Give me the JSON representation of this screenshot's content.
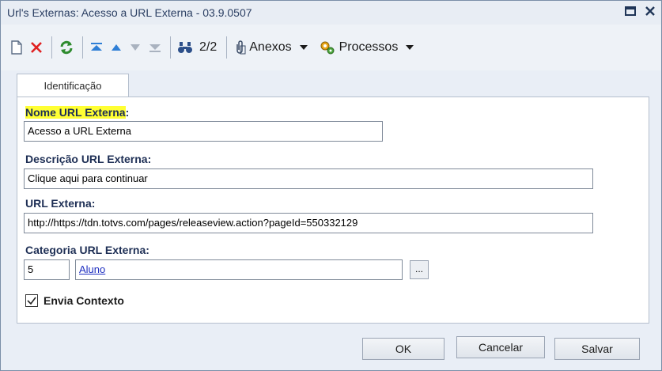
{
  "window": {
    "title": "Url's Externas: Acesso a URL Externa - 03.9.0507"
  },
  "toolbar": {
    "record_counter": "2/2",
    "attachments_label": "Anexos",
    "processes_label": "Processos"
  },
  "tabs": [
    {
      "label": "Identificação"
    }
  ],
  "form": {
    "name_label": "Nome URL Externa",
    "name_colon": ":",
    "name_value": "Acesso a URL Externa",
    "description_label": "Descrição URL Externa:",
    "description_value": "Clique aqui para continuar",
    "url_label": "URL Externa:",
    "url_value": "http://https://tdn.totvs.com/pages/releaseview.action?pageId=550332129",
    "category_label": "Categoria URL Externa:",
    "category_code": "5",
    "category_name": "Aluno",
    "browse_label": "...",
    "send_context_label": "Envia Contexto",
    "send_context_checked": true
  },
  "footer": {
    "ok_label": "OK",
    "cancel_label": "Cancelar",
    "save_label": "Salvar"
  },
  "colors": {
    "highlight": "#ffff33",
    "link": "#1d2ec0",
    "delete_red": "#e02020",
    "refresh_green": "#2e8b2e",
    "nav_blue": "#2f7fd6"
  }
}
